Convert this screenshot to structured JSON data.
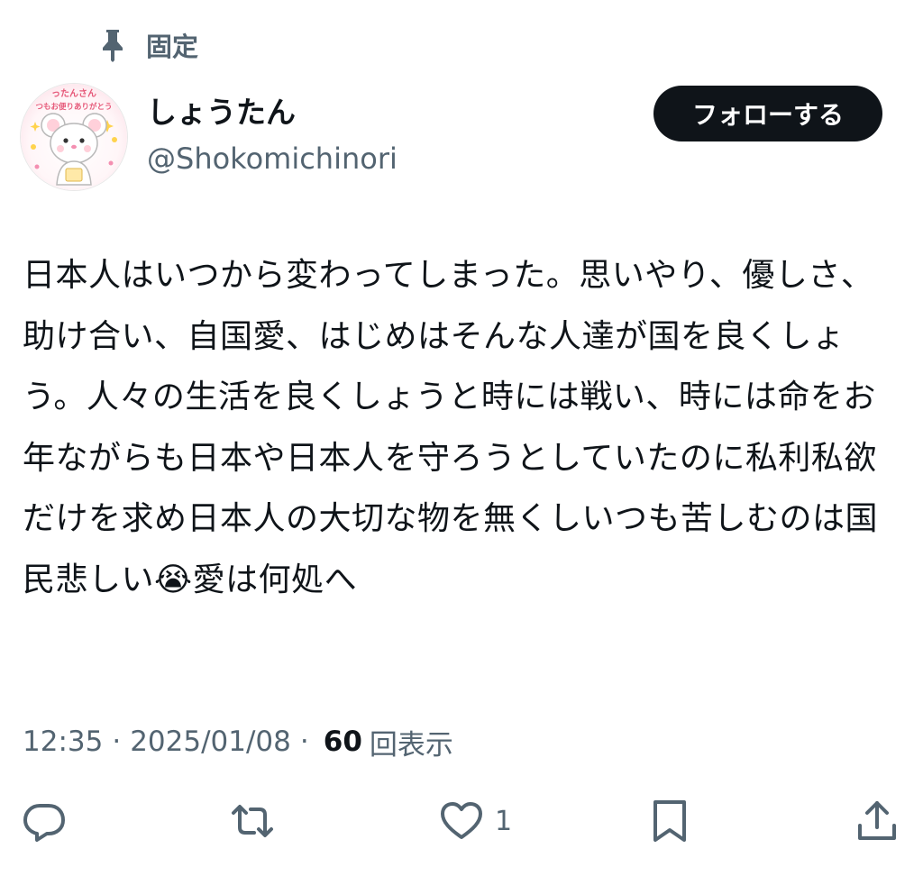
{
  "pinned": {
    "icon": "pin-icon",
    "label": "固定"
  },
  "author": {
    "avatar_icon": "avatar-mouse-illustration",
    "display_name": "しょうたん",
    "handle": "@Shokomichinori",
    "avatar_text_line1": "ったんさん",
    "avatar_text_line2": "つもお便りありがとう"
  },
  "follow_button": {
    "label": "フォローする"
  },
  "tweet": {
    "text": "日本人はいつから変わってしまった。思いやり、優しさ、助け合い、自国愛、はじめはそんな人達が国を良くしょう。人々の生活を良くしょうと時には戦い、時には命をお年ながらも日本や日本人を守ろうとしていたのに私利私欲だけを求め日本人の大切な物を無くしいつも苦しむのは国民悲しい😭愛は何処へ"
  },
  "meta": {
    "time": "12:35",
    "separator": "·",
    "date": "2025/01/08",
    "views_count": "60",
    "views_label": "回表示"
  },
  "actions": {
    "reply_icon": "reply-icon",
    "retweet_icon": "retweet-icon",
    "like_icon": "heart-icon",
    "like_count": "1",
    "bookmark_icon": "bookmark-icon",
    "share_icon": "share-icon"
  },
  "colors": {
    "text_primary": "#0f1419",
    "text_secondary": "#536471",
    "button_bg": "#0f1419",
    "button_text": "#ffffff"
  }
}
